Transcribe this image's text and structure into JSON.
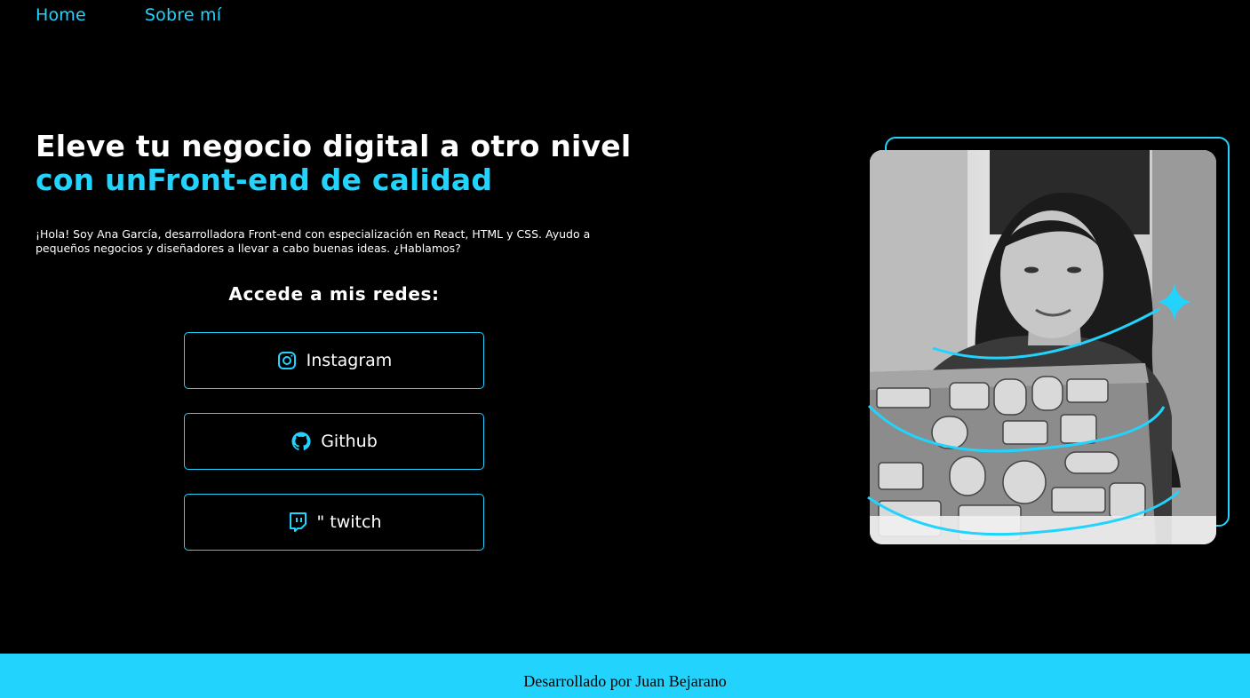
{
  "nav": {
    "home": "Home",
    "about": "Sobre mí"
  },
  "hero": {
    "title_plain": "Eleve tu negocio digital a otro nivel ",
    "title_accent": "con unFront-end de calidad",
    "intro": "¡Hola! Soy Ana García, desarrolladora Front-end con especialización en React, HTML y CSS. Ayudo a pequeños negocios y diseñadores a llevar a cabo buenas ideas. ¿Hablamos?"
  },
  "social": {
    "title": "Accede a mis redes:",
    "buttons": [
      {
        "label": "Instagram",
        "icon": "instagram-icon"
      },
      {
        "label": "Github",
        "icon": "github-icon"
      },
      {
        "label": "\" twitch",
        "icon": "twitch-icon"
      }
    ]
  },
  "footer": {
    "text": "Desarrollado por Juan Bejarano"
  },
  "colors": {
    "accent": "#22d4fd",
    "background": "#000000",
    "text": "#ffffff"
  }
}
